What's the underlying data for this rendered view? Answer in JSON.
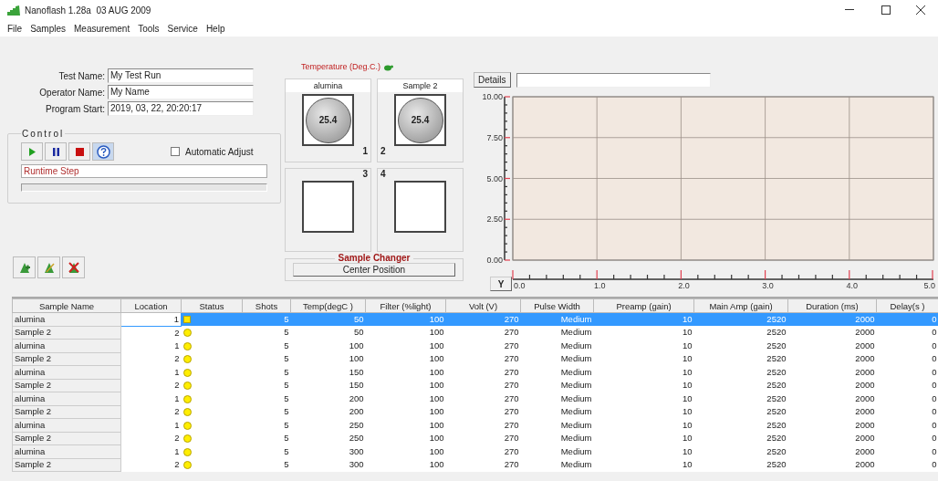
{
  "window": {
    "title": "Nanoflash 1.28a  03 AUG 2009"
  },
  "menu": [
    "File",
    "Samples",
    "Measurement",
    "Tools",
    "Service",
    "Help"
  ],
  "fields": [
    {
      "label": "Test Name:",
      "value": "My Test Run"
    },
    {
      "label": "Operator Name:",
      "value": "My Name"
    },
    {
      "label": "Program Start:",
      "value": "2019, 03, 22, 20:20:17"
    }
  ],
  "control": {
    "title": "Control",
    "automatic_adjust": {
      "label": "Automatic Adjust",
      "checked": false
    },
    "step": "Runtime Step",
    "progress": {
      "level": 0
    }
  },
  "temperature": {
    "label": "Temperature (Deg.C.)"
  },
  "positions": [
    {
      "number": "1",
      "label": "alumina",
      "reading": "25.4",
      "loaded": true
    },
    {
      "number": "2",
      "label": "Sample 2",
      "reading": "25.4",
      "loaded": true
    },
    {
      "number": "3",
      "loaded": false
    },
    {
      "number": "4",
      "loaded": false
    }
  ],
  "sample_changer": {
    "title": "Sample Changer",
    "button": "Center Position"
  },
  "details": {
    "button": "Details"
  },
  "y_button": "Y",
  "chart_data": {
    "type": "line",
    "grid": true,
    "xlim": [
      0,
      5
    ],
    "ylim": [
      0,
      10
    ],
    "xticks": [
      {
        "value": 0,
        "label": "0.0"
      },
      {
        "value": 1,
        "label": "1.0"
      },
      {
        "value": 2,
        "label": "2.0"
      },
      {
        "value": 3,
        "label": "3.0"
      },
      {
        "value": 4,
        "label": "4.0"
      },
      {
        "value": 5,
        "label": "5.0"
      }
    ],
    "yticks": [
      {
        "value": 0,
        "label": "0.00"
      },
      {
        "value": 2.5,
        "label": "2.50"
      },
      {
        "value": 5,
        "label": "5.00"
      },
      {
        "value": 7.5,
        "label": "7.50"
      },
      {
        "value": 10,
        "label": "10.00"
      }
    ]
  },
  "table": {
    "columns": [
      "Sample Name",
      "Location",
      "Status",
      "Shots",
      "Temp(degC )",
      "Filter (%light)",
      "Volt (V)",
      "Pulse Width",
      "Preamp (gain)",
      "Main Amp (gain)",
      "Duration (ms)",
      "Delay(s )"
    ],
    "rows": [
      {
        "selected": true,
        "editing": true,
        "kind": "square",
        "cells": [
          "alumina",
          "1",
          "",
          "5",
          "50",
          "100",
          "270",
          "Medium",
          "10",
          "2520",
          "2000",
          "0"
        ]
      },
      {
        "selected": false,
        "editing": false,
        "kind": "circle",
        "cells": [
          "Sample 2",
          "2",
          "",
          "5",
          "50",
          "100",
          "270",
          "Medium",
          "10",
          "2520",
          "2000",
          "0"
        ]
      },
      {
        "selected": false,
        "editing": false,
        "kind": "circle",
        "cells": [
          "alumina",
          "1",
          "",
          "5",
          "100",
          "100",
          "270",
          "Medium",
          "10",
          "2520",
          "2000",
          "0"
        ]
      },
      {
        "selected": false,
        "editing": false,
        "kind": "circle",
        "cells": [
          "Sample 2",
          "2",
          "",
          "5",
          "100",
          "100",
          "270",
          "Medium",
          "10",
          "2520",
          "2000",
          "0"
        ]
      },
      {
        "selected": false,
        "editing": false,
        "kind": "circle",
        "cells": [
          "alumina",
          "1",
          "",
          "5",
          "150",
          "100",
          "270",
          "Medium",
          "10",
          "2520",
          "2000",
          "0"
        ]
      },
      {
        "selected": false,
        "editing": false,
        "kind": "circle",
        "cells": [
          "Sample 2",
          "2",
          "",
          "5",
          "150",
          "100",
          "270",
          "Medium",
          "10",
          "2520",
          "2000",
          "0"
        ]
      },
      {
        "selected": false,
        "editing": false,
        "kind": "circle",
        "cells": [
          "alumina",
          "1",
          "",
          "5",
          "200",
          "100",
          "270",
          "Medium",
          "10",
          "2520",
          "2000",
          "0"
        ]
      },
      {
        "selected": false,
        "editing": false,
        "kind": "circle",
        "cells": [
          "Sample 2",
          "2",
          "",
          "5",
          "200",
          "100",
          "270",
          "Medium",
          "10",
          "2520",
          "2000",
          "0"
        ]
      },
      {
        "selected": false,
        "editing": false,
        "kind": "circle",
        "cells": [
          "alumina",
          "1",
          "",
          "5",
          "250",
          "100",
          "270",
          "Medium",
          "10",
          "2520",
          "2000",
          "0"
        ]
      },
      {
        "selected": false,
        "editing": false,
        "kind": "circle",
        "cells": [
          "Sample 2",
          "2",
          "",
          "5",
          "250",
          "100",
          "270",
          "Medium",
          "10",
          "2520",
          "2000",
          "0"
        ]
      },
      {
        "selected": false,
        "editing": false,
        "kind": "circle",
        "cells": [
          "alumina",
          "1",
          "",
          "5",
          "300",
          "100",
          "270",
          "Medium",
          "10",
          "2520",
          "2000",
          "0"
        ]
      },
      {
        "selected": false,
        "editing": false,
        "kind": "circle",
        "cells": [
          "Sample 2",
          "2",
          "",
          "5",
          "300",
          "100",
          "270",
          "Medium",
          "10",
          "2520",
          "2000",
          "0"
        ]
      }
    ]
  }
}
